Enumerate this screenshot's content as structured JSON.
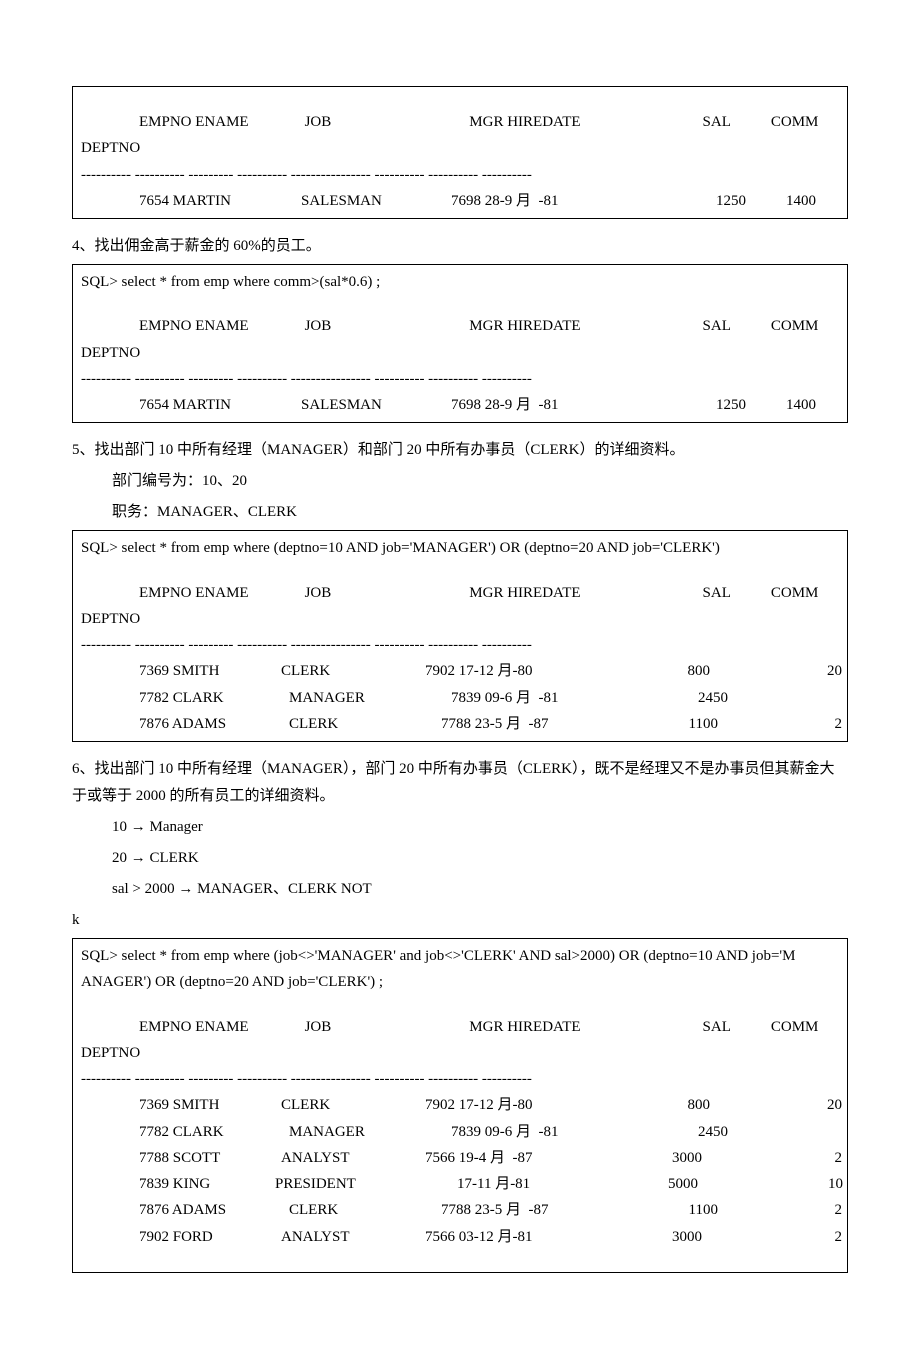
{
  "headers": {
    "col_empno_ename": "EMPNO ENAME",
    "col_job": "JOB",
    "col_mgr_hiredate": "MGR HIREDATE",
    "col_sal": "SAL",
    "col_comm": "COMM",
    "col_deptno": "DEPTNO",
    "separator": "---------- ---------- --------- ---------- ---------------- ---------- ---------- ----------"
  },
  "r1": {
    "empno": "7654 MARTIN",
    "job": "SALESMAN",
    "mgr": "7698 28-9 月  -81",
    "sal": "1250",
    "comm": "1400"
  },
  "q4": {
    "title": "4、找出佣金高于薪金的 60%的员工。",
    "sql": "SQL> select * from emp where comm>(sal*0.6) ;"
  },
  "q5": {
    "title": "5、找出部门 10 中所有经理（MANAGER）和部门 20 中所有办事员（CLERK）的详细资料。",
    "note1": "部门编号为：10、20",
    "note2": "职务：MANAGER、CLERK",
    "sql": "SQL> select * from emp where (deptno=10 AND job='MANAGER') OR (deptno=20 AND job='CLERK')",
    "rows": [
      {
        "empno": "7369 SMITH",
        "job": "CLERK",
        "mgr": "7902 17-12 月-80",
        "sal": "800",
        "comm": "20"
      },
      {
        "empno": "7782 CLARK",
        "job": "MANAGER",
        "mgr": "7839 09-6 月  -81",
        "sal": "2450",
        "comm": ""
      },
      {
        "empno": "7876 ADAMS",
        "job": "CLERK",
        "mgr": "7788 23-5 月  -87",
        "sal": "1100",
        "comm": "2"
      }
    ]
  },
  "q6": {
    "title": "6、找出部门 10 中所有经理（MANAGER），部门 20 中所有办事员（CLERK），既不是经理又不是办事员但其薪金大于或等于 2000 的所有员工的详细资料。",
    "note1": "10 → Manager",
    "note2": "20 → CLERK",
    "note3": "sal > 2000 → MANAGER、CLERK NOT",
    "k": "k",
    "sql1": "SQL> select * from emp where (job<>'MANAGER' and job<>'CLERK' AND sal>2000) OR (deptno=10 AND job='M",
    "sql2": "ANAGER') OR (deptno=20 AND job='CLERK') ;",
    "rows": [
      {
        "empno": "7369 SMITH",
        "job": "CLERK",
        "mgr": "7902 17-12 月-80",
        "sal": "800",
        "comm": "20"
      },
      {
        "empno": "7782 CLARK",
        "job": "MANAGER",
        "mgr": "7839 09-6 月  -81",
        "sal": "2450",
        "comm": ""
      },
      {
        "empno": "7788 SCOTT",
        "job": "ANALYST",
        "mgr": "7566 19-4 月  -87",
        "sal": "3000",
        "comm": "2"
      },
      {
        "empno": "7839 KING",
        "job": "PRESIDENT",
        "mgr": "17-11 月-81",
        "sal": "5000",
        "comm": "10"
      },
      {
        "empno": "7876 ADAMS",
        "job": "CLERK",
        "mgr": "7788 23-5 月  -87",
        "sal": "1100",
        "comm": "2"
      },
      {
        "empno": "7902 FORD",
        "job": "ANALYST",
        "mgr": "7566 03-12 月-81",
        "sal": "3000",
        "comm": "2"
      }
    ]
  }
}
